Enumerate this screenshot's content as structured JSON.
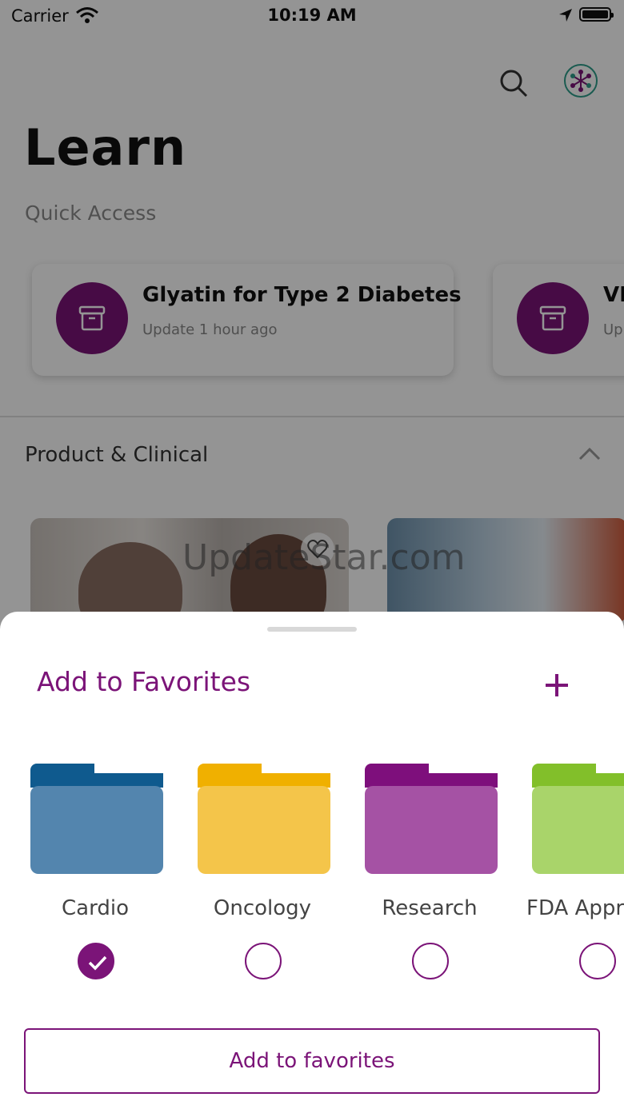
{
  "status_bar": {
    "carrier": "Carrier",
    "time": "10:19 AM"
  },
  "header": {
    "title": "Learn",
    "quick_access_label": "Quick Access"
  },
  "quick_access": [
    {
      "title": "Glyatin for Type 2 Diabetes",
      "subtitle": "Update 1 hour ago",
      "icon": "archive-icon"
    },
    {
      "title": "VI",
      "subtitle": "Up",
      "icon": "archive-icon"
    }
  ],
  "section": {
    "title": "Product & Clinical"
  },
  "watermark": "UpdateStar.com",
  "sheet": {
    "title": "Add to Favorites",
    "folders": [
      {
        "label": "Cardio",
        "checked": true,
        "color_tab": "#0f5a8e",
        "color_body": "#5385ae"
      },
      {
        "label": "Oncology",
        "checked": false,
        "color_tab": "#f0b000",
        "color_body": "#f4c54a"
      },
      {
        "label": "Research",
        "checked": false,
        "color_tab": "#7e0f7c",
        "color_body": "#a552a4"
      },
      {
        "label": "FDA Appro",
        "checked": false,
        "color_tab": "#82bf2a",
        "color_body": "#a9d46a"
      }
    ],
    "button_label": "Add to favorites"
  },
  "colors": {
    "accent": "#7b1478",
    "overlay": "rgba(0,0,0,0.42)"
  }
}
